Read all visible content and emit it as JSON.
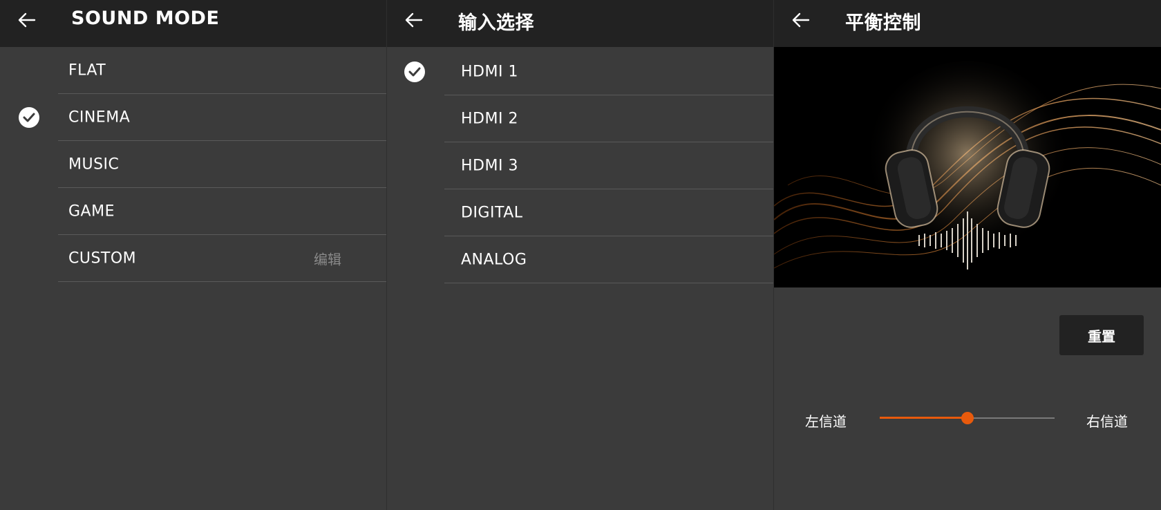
{
  "colors": {
    "accent": "#e85a0c",
    "background": "#3b3b3b",
    "header": "#222222",
    "divider": "#5a5a5a"
  },
  "sound_mode": {
    "title": "SOUND MODE",
    "back_icon": "arrow-left-icon",
    "selected_index": 1,
    "items": [
      {
        "label": "FLAT"
      },
      {
        "label": "CINEMA"
      },
      {
        "label": "MUSIC"
      },
      {
        "label": "GAME"
      },
      {
        "label": "CUSTOM",
        "edit_label": "编辑"
      }
    ]
  },
  "input_select": {
    "title": "输入选择",
    "back_icon": "arrow-left-icon",
    "selected_index": 0,
    "items": [
      {
        "label": "HDMI 1"
      },
      {
        "label": "HDMI 2"
      },
      {
        "label": "HDMI 3"
      },
      {
        "label": "DIGITAL"
      },
      {
        "label": "ANALOG"
      }
    ]
  },
  "balance": {
    "title": "平衡控制",
    "back_icon": "arrow-left-icon",
    "hero_icon": "headphones-image",
    "reset_label": "重置",
    "left_label": "左信道",
    "right_label": "右信道",
    "value": 0.5
  }
}
